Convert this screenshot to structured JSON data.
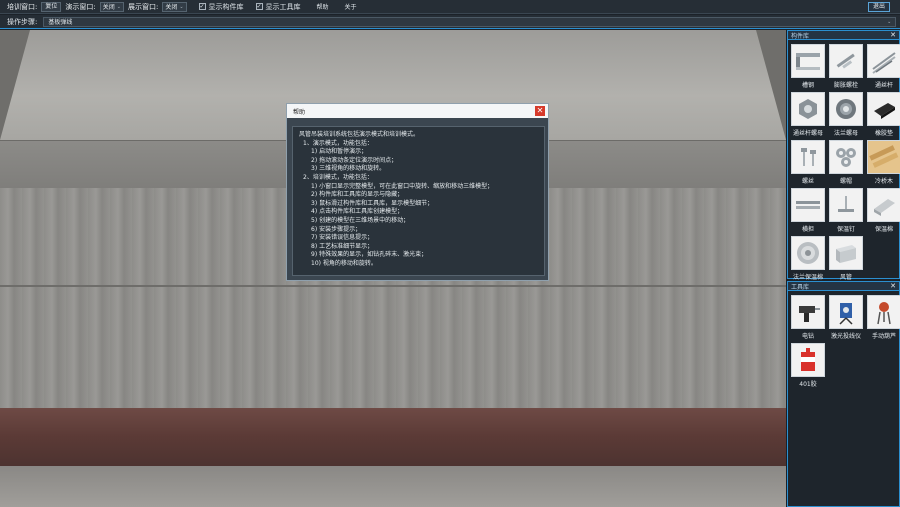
{
  "topbar": {
    "training_window_label": "培训窗口:",
    "reset_button": "复位",
    "demo_window_label": "演示窗口:",
    "demo_window_value": "关闭",
    "display_window_label": "展示窗口:",
    "display_window_value": "关闭",
    "show_component_lib": "显示构件库",
    "show_tool_lib": "显示工具库",
    "help": "帮助",
    "about": "关于",
    "exit": "退出"
  },
  "stepbar": {
    "label": "操作步骤:",
    "value": "基板弹线"
  },
  "component_panel": {
    "title": "构件库",
    "items": [
      {
        "label": "槽钢",
        "icon": "channel-steel-icon"
      },
      {
        "label": "膨胀螺栓",
        "icon": "expansion-bolt-icon"
      },
      {
        "label": "通丝杆",
        "icon": "threaded-rod-icon"
      },
      {
        "label": "通丝杆螺母",
        "icon": "rod-nut-icon"
      },
      {
        "label": "法兰螺母",
        "icon": "flange-nut-icon"
      },
      {
        "label": "橡胶垫",
        "icon": "rubber-pad-icon"
      },
      {
        "label": "螺丝",
        "icon": "screw-icon"
      },
      {
        "label": "螺帽",
        "icon": "nut-icon"
      },
      {
        "label": "冷桥木",
        "icon": "cold-bridge-wood-icon"
      },
      {
        "label": "横担",
        "icon": "crossarm-icon"
      },
      {
        "label": "保温钉",
        "icon": "insulation-pin-icon"
      },
      {
        "label": "保温棉",
        "icon": "insulation-cotton-icon"
      },
      {
        "label": "法兰保温棉",
        "icon": "flange-insulation-icon"
      },
      {
        "label": "风管",
        "icon": "air-duct-icon"
      }
    ]
  },
  "tool_panel": {
    "title": "工具库",
    "items": [
      {
        "label": "电钻",
        "icon": "electric-drill-icon"
      },
      {
        "label": "激光投线仪",
        "icon": "laser-level-icon"
      },
      {
        "label": "手动葫芦",
        "icon": "chain-hoist-icon"
      },
      {
        "label": "401胶",
        "icon": "glue-401-icon"
      }
    ]
  },
  "help_dialog": {
    "title": "帮助",
    "lines": [
      {
        "text": "风管吊装培训系统包括演示模式和培训模式。",
        "level": 0
      },
      {
        "text": "1、演示模式，功能包括：",
        "level": 1
      },
      {
        "text": "1) 启动和暂停演示；",
        "level": 2
      },
      {
        "text": "2) 拖动滚动条定位演示时间点；",
        "level": 2
      },
      {
        "text": "3) 三维视角的移动和旋转。",
        "level": 2
      },
      {
        "text": "2、培训模式，功能包括：",
        "level": 1
      },
      {
        "text": "1) 小窗口显示完整模型，可在此窗口中旋转、缩放和移动三维模型；",
        "level": 2
      },
      {
        "text": "2) 构件库和工具库的显示与隐藏；",
        "level": 2
      },
      {
        "text": "3) 鼠标滑过构件库和工具库，显示模型细节；",
        "level": 2
      },
      {
        "text": "4) 点击构件库和工具库创建模型；",
        "level": 2
      },
      {
        "text": "5) 创建的模型在三维场景中的移动；",
        "level": 2
      },
      {
        "text": "6) 安装步骤提示；",
        "level": 2
      },
      {
        "text": "7) 安装错误信息提示；",
        "level": 2
      },
      {
        "text": "8) 工艺标准细节显示；",
        "level": 2
      },
      {
        "text": "9) 特殊效果的显示，如钻孔碎末、激光束；",
        "level": 2
      },
      {
        "text": "10) 视角的移动和旋转。",
        "level": 2
      }
    ]
  }
}
